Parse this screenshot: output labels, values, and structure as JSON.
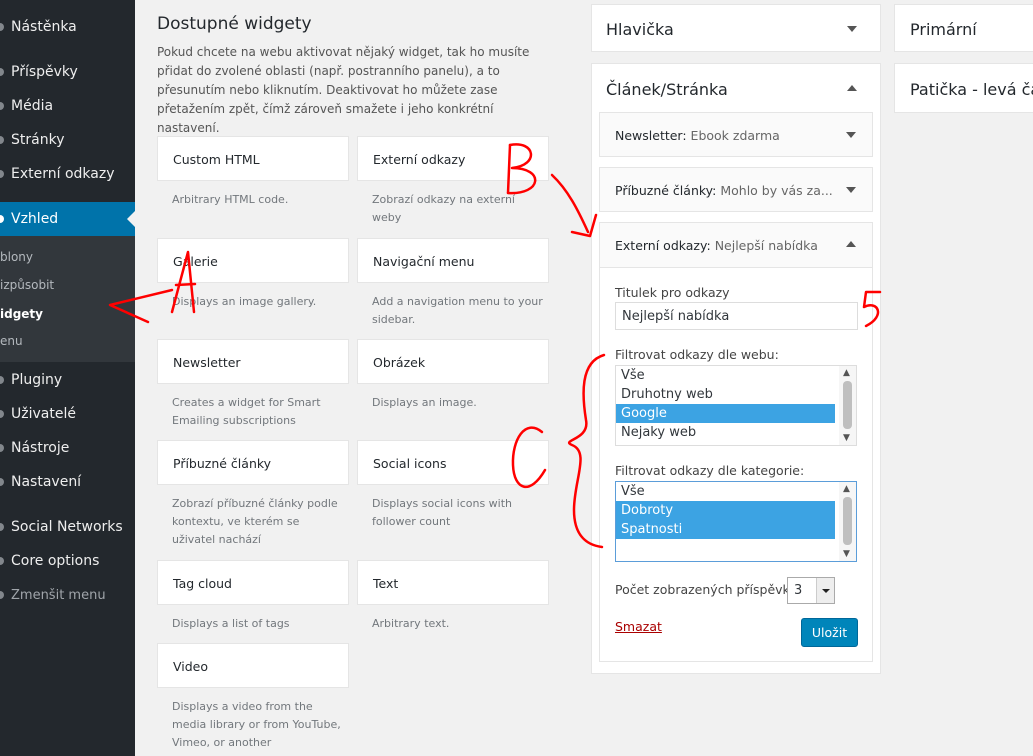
{
  "sidebar": {
    "items": [
      {
        "label": "Nástěnka"
      },
      {
        "label": "Příspěvky"
      },
      {
        "label": "Média"
      },
      {
        "label": "Stránky"
      },
      {
        "label": "Externí odkazy"
      },
      {
        "label": "Vzhled"
      },
      {
        "label": "Pluginy"
      },
      {
        "label": "Uživatelé"
      },
      {
        "label": "Nástroje"
      },
      {
        "label": "Nastavení"
      },
      {
        "label": "Social Networks"
      },
      {
        "label": "Core options"
      },
      {
        "label": "Zmenšit menu"
      }
    ],
    "submenu": [
      {
        "label": "blony"
      },
      {
        "label": "izpůsobit"
      },
      {
        "label": "idgety"
      },
      {
        "label": "enu"
      }
    ]
  },
  "available": {
    "title": "Dostupné widgety",
    "description": "Pokud chcete na webu aktivovat nějaký widget, tak ho musíte přidat do zvolené oblasti (např. postranního panelu), a to přesunutím nebo kliknutím. Deaktivovat ho můžete zase přetažením zpět, čímž zároveň smažete i jeho konkrétní nastavení.",
    "widgets": [
      {
        "title": "Custom HTML",
        "desc": "Arbitrary HTML code."
      },
      {
        "title": "Externí odkazy",
        "desc": "Zobrazí odkazy na externí weby"
      },
      {
        "title": "Galerie",
        "desc": "Displays an image gallery."
      },
      {
        "title": "Navigační menu",
        "desc": "Add a navigation menu to your sidebar."
      },
      {
        "title": "Newsletter",
        "desc": "Creates a widget for Smart Emailing subscriptions"
      },
      {
        "title": "Obrázek",
        "desc": "Displays an image."
      },
      {
        "title": "Příbuzné články",
        "desc": "Zobrazí příbuzné články podle kontextu, ve kterém se uživatel nachází"
      },
      {
        "title": "Social icons",
        "desc": "Displays social icons with follower count"
      },
      {
        "title": "Tag cloud",
        "desc": "Displays a list of tags"
      },
      {
        "title": "Text",
        "desc": "Arbitrary text."
      },
      {
        "title": "Video",
        "desc": "Displays a video from the media library or from YouTube, Vimeo, or another"
      }
    ]
  },
  "areas": {
    "header": "Hlavička",
    "article": "Článek/Stránka",
    "primary": "Primární",
    "footer_left": "Patička - levá čá"
  },
  "article_widgets": [
    {
      "name": "Newsletter",
      "sub": "Ebook zdarma"
    },
    {
      "name": "Příbuzné články",
      "sub": "Mohlo by vás za..."
    },
    {
      "name": "Externí odkazy",
      "sub": "Nejlepší nabídka"
    }
  ],
  "form": {
    "title_label": "Titulek pro odkazy",
    "title_value": "Nejlepší nabídka",
    "web_label": "Filtrovat odkazy dle webu:",
    "web_options": [
      {
        "label": "Vše",
        "selected": false
      },
      {
        "label": "Druhotny web",
        "selected": false
      },
      {
        "label": "Google",
        "selected": true
      },
      {
        "label": "Nejaky web",
        "selected": false
      }
    ],
    "category_label": "Filtrovat odkazy dle kategorie:",
    "category_options": [
      {
        "label": "Vše",
        "selected": false
      },
      {
        "label": "Dobroty",
        "selected": true
      },
      {
        "label": "Spatnosti",
        "selected": true
      }
    ],
    "count_label": "Počet zobrazených příspěvků",
    "count_value": "3",
    "delete_label": "Smazat",
    "save_label": "Uložit"
  },
  "annotations": {
    "a": "A",
    "b": "B",
    "c": "C",
    "five": "5",
    "color": "#ff0000"
  }
}
